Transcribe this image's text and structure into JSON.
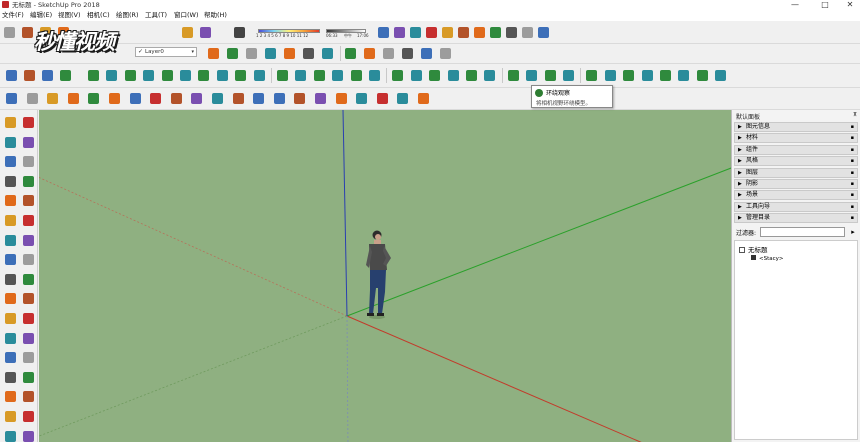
{
  "window": {
    "title": "无标题 - SketchUp Pro 2018",
    "minimize": "—",
    "maximize": "□",
    "close": "✕"
  },
  "menu": [
    "文件(F)",
    "编辑(E)",
    "视图(V)",
    "相机(C)",
    "绘图(R)",
    "工具(T)",
    "窗口(W)",
    "帮助(H)"
  ],
  "watermark": "秒懂视频",
  "layer": {
    "check": "✓",
    "value": "Layer0",
    "arrow": "▾"
  },
  "shadow": {
    "month_numbers": "1 2 3 4 5 6 7 8 9 10 11 12",
    "time_start": "06:33",
    "time_mid": "中午",
    "time_end": "17:06"
  },
  "tooltip": {
    "title": "环绕观察",
    "description": "将相机视野环绕模型。"
  },
  "panel": {
    "header": "默认面板",
    "pin": "⊼",
    "sections": [
      "图元信息",
      "材料",
      "组件",
      "风格",
      "图层",
      "阴影",
      "场景",
      "工具向导",
      "管理目录"
    ],
    "filter_label": "过滤器:",
    "filter_value": "",
    "filter_button": "▸",
    "outliner": {
      "root": "无标题",
      "child": "<Stacy>"
    }
  },
  "colors": {
    "viewport_bg": "#8fb081",
    "axis_red": "#c23b2b",
    "axis_green": "#2aa02a",
    "axis_blue": "#2a3fb0"
  },
  "icons": {
    "toolbar_row1": [
      "new-icon",
      "open-icon",
      "save-icon",
      "cut-icon",
      "copy-icon",
      "paste-icon",
      "erase-icon",
      "undo-icon",
      "redo-icon",
      "print-icon",
      "model-info-icon",
      "shadows-icon",
      "warehouse-icon",
      "extension-warehouse-icon",
      "share-component-icon",
      "send-to-layout-icon",
      "extension-manager-icon"
    ],
    "toolbar_row2": [
      "xray-icon",
      "back-edges-icon",
      "wireframe-icon",
      "hidden-line-icon",
      "shaded-icon",
      "shaded-textures-icon",
      "monochrome-icon",
      "iso-view-icon",
      "top-view-icon",
      "front-view-icon",
      "right-view-icon",
      "back-view-icon",
      "left-view-icon"
    ],
    "toolbar_row3": [
      "select-icon",
      "make-component-icon",
      "paint-bucket-icon",
      "eraser-icon",
      "line-icon",
      "freehand-icon",
      "rectangle-icon",
      "rotated-rect-icon",
      "circle-icon",
      "polygon-icon",
      "arc-icon",
      "two-point-arc-icon",
      "three-point-arc-icon",
      "pie-icon",
      "move-icon",
      "push-pull-icon",
      "rotate-icon",
      "follow-me-icon",
      "scale-icon",
      "offset-icon",
      "tape-measure-icon",
      "dimension-icon",
      "protractor-icon",
      "text-icon",
      "axes-icon",
      "3d-text-icon",
      "orbit-icon",
      "pan-icon",
      "zoom-icon",
      "zoom-window-icon",
      "zoom-extents-icon",
      "position-camera-icon",
      "look-around-icon",
      "walk-icon",
      "section-plane-icon",
      "display-sections-icon",
      "section-cuts-icon",
      "section-fill-icon"
    ],
    "toolbar_row4": [
      "select-icon",
      "eraser-icon",
      "line-icon",
      "arc-icon",
      "rectangle-icon",
      "push-pull-icon",
      "move-icon",
      "rotate-icon",
      "scale-icon",
      "offset-icon",
      "tape-measure-icon",
      "text-icon",
      "paint-bucket-icon",
      "orbit-icon",
      "pan-icon",
      "zoom-icon",
      "zoom-extents-icon",
      "previous-view-icon",
      "warehouse-icon",
      "extension-warehouse-icon",
      "send-to-layout-icon"
    ]
  }
}
